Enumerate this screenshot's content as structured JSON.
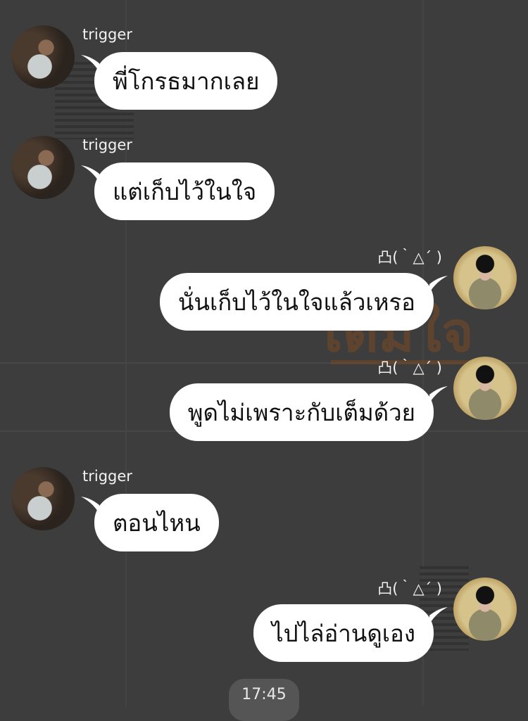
{
  "chat": {
    "messages": [
      {
        "side": "left",
        "sender": "trigger",
        "text": "พี่โกรธมากเลย"
      },
      {
        "side": "left",
        "sender": "trigger",
        "text": "แต่เก็บไว้ในใจ"
      },
      {
        "side": "right",
        "sender": "凸(｀△´ )",
        "text": "นั่นเก็บไว้ในใจแล้วเหรอ"
      },
      {
        "side": "right",
        "sender": "凸(｀△´ )",
        "text": "พูดไม่เพราะกับเต็มด้วย"
      },
      {
        "side": "left",
        "sender": "trigger",
        "text": "ตอนไหน"
      },
      {
        "side": "right",
        "sender": "凸(｀△´ )",
        "text": "ไปไล่อ่านดูเอง"
      }
    ],
    "timestamp": "17:45"
  },
  "background": {
    "deco_text": "เต็มใจ"
  },
  "colors": {
    "bubble": "#ffffff",
    "background": "#3d3d3d",
    "name_text": "#f2f2f2"
  }
}
